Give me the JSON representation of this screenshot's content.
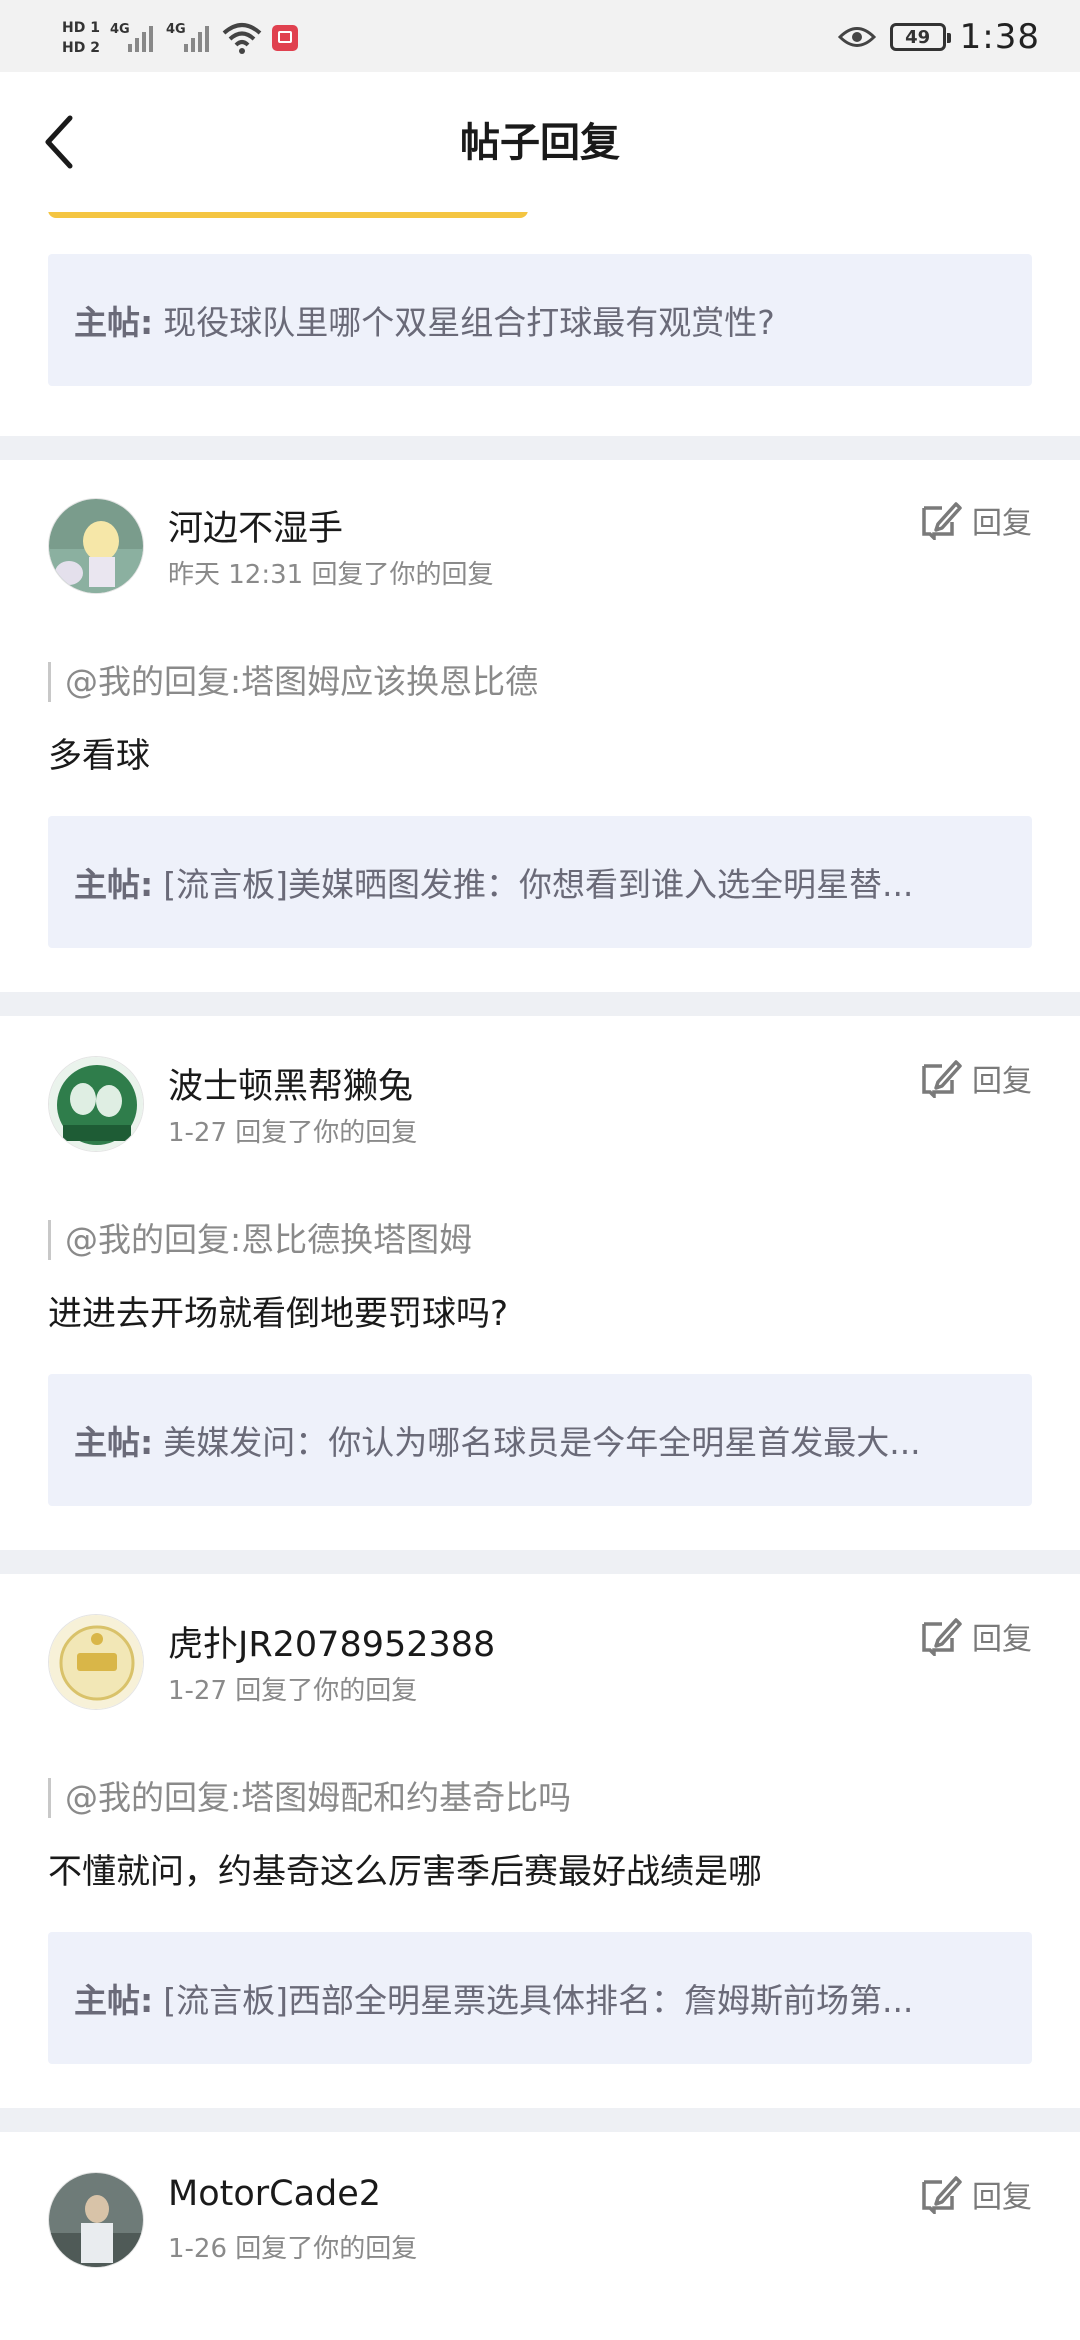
{
  "status_bar": {
    "hd1": "HD 1",
    "hd2": "HD 2",
    "sig1": "4G",
    "sig2": "4G",
    "battery": "49",
    "time": "1:38"
  },
  "nav": {
    "title": "帖子回复",
    "back_icon": "chevron-left-icon"
  },
  "first_item": {
    "prefix": "主帖:",
    "main_post": "现役球队里哪个双星组合打球最有观赏性?"
  },
  "replies": [
    {
      "user": "河边不湿手",
      "meta": "昨天 12:31 回复了你的回复",
      "reply_label": "回复",
      "quote": "@我的回复:塔图姆应该换恩比德",
      "body": "多看球",
      "main_prefix": "主帖:",
      "main_post": "[流言板]美媒晒图发推：你想看到谁入选全明星替..."
    },
    {
      "user": "波士顿黑帮獭兔",
      "meta": "1-27 回复了你的回复",
      "reply_label": "回复",
      "quote": "@我的回复:恩比德换塔图姆",
      "body": "进进去开场就看倒地要罚球吗?",
      "main_prefix": "主帖:",
      "main_post": "美媒发问：你认为哪名球员是今年全明星首发最大..."
    },
    {
      "user": "虎扑JR2078952388",
      "meta": "1-27 回复了你的回复",
      "reply_label": "回复",
      "quote": "@我的回复:塔图姆配和约基奇比吗",
      "body": "不懂就问，约基奇这么厉害季后赛最好战绩是哪",
      "main_prefix": "主帖:",
      "main_post": "[流言板]西部全明星票选具体排名：詹姆斯前场第..."
    },
    {
      "user": "MotorCade2",
      "meta": "1-26 回复了你的回复",
      "reply_label": "回复"
    }
  ],
  "colors": {
    "status_bg": "#f2f2f2",
    "main_box_bg": "#eef1fa",
    "divider": "#eef0f4",
    "notif": "#e0414f"
  }
}
